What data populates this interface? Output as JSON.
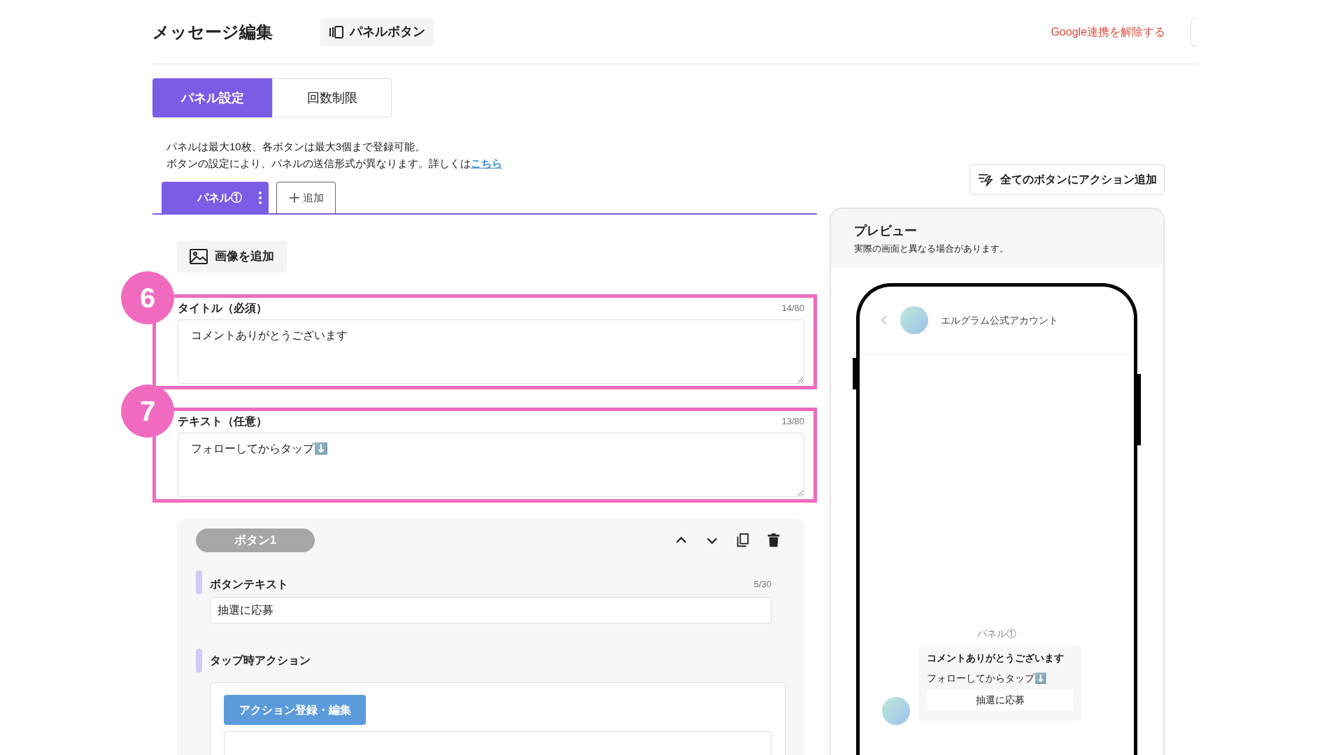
{
  "header": {
    "title": "メッセージ編集",
    "panel_button": "パネルボタン",
    "google_unlink": "Google連携を解除する"
  },
  "tabs": [
    {
      "label": "パネル設定",
      "selected": true
    },
    {
      "label": "回数制限",
      "selected": false
    }
  ],
  "notes": {
    "line1": "パネルは最大10枚、各ボタンは最大3個まで登録可能。",
    "line2": "ボタンの設定により、パネルの送信形式が異なります。詳しくは",
    "link": "こちら"
  },
  "panel_tabs": [
    {
      "label": "パネル①",
      "selected": true
    }
  ],
  "add_tab": "追加",
  "add_image": "画像を追加",
  "fields": [
    {
      "badge": "6",
      "label": "タイトル（必須）",
      "count": "14/80",
      "value": "コメントありがとうございます"
    },
    {
      "badge": "7",
      "label": "テキスト（任意）",
      "count": "13/80",
      "value": "フォローしてからタップ⬇️"
    }
  ],
  "button_card": {
    "name": "ボタン1",
    "text_label": "ボタンテキスト",
    "text_count": "5/30",
    "text_value": "抽選に応募",
    "action_label": "タップ時アクション",
    "action_button": "アクション登録・編集"
  },
  "bulk_action": "全てのボタンにアクション追加",
  "preview": {
    "title": "プレビュー",
    "subtitle": "実際の画面と異なる場合があります。",
    "account": "エルグラム公式アカウント",
    "panel_label": "パネル①",
    "message_title": "コメントありがとうございます",
    "message_text": "フォローしてからタップ⬇️",
    "message_button": "抽選に応募"
  }
}
